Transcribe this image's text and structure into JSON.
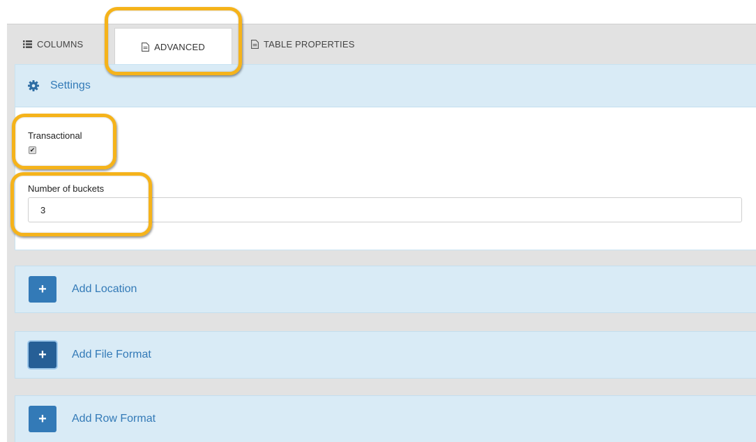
{
  "tabs": [
    {
      "label": "COLUMNS",
      "icon": "list-icon",
      "active": false
    },
    {
      "label": "ADVANCED",
      "icon": "document-icon",
      "active": true
    },
    {
      "label": "TABLE PROPERTIES",
      "icon": "document-icon",
      "active": false
    }
  ],
  "settings": {
    "title": "Settings",
    "icon": "gear-icon",
    "transactional": {
      "label": "Transactional",
      "checked": true
    },
    "buckets": {
      "label": "Number of buckets",
      "value": "3"
    }
  },
  "sections": [
    {
      "label": "Add Location",
      "button": "+"
    },
    {
      "label": "Add File Format",
      "button": "+"
    },
    {
      "label": "Add Row Format",
      "button": "+"
    }
  ],
  "colors": {
    "accent": "#337ab7",
    "header_bg": "#d9ebf6",
    "highlight": "#f5b31b",
    "panel_bg": "#e2e2e2"
  }
}
